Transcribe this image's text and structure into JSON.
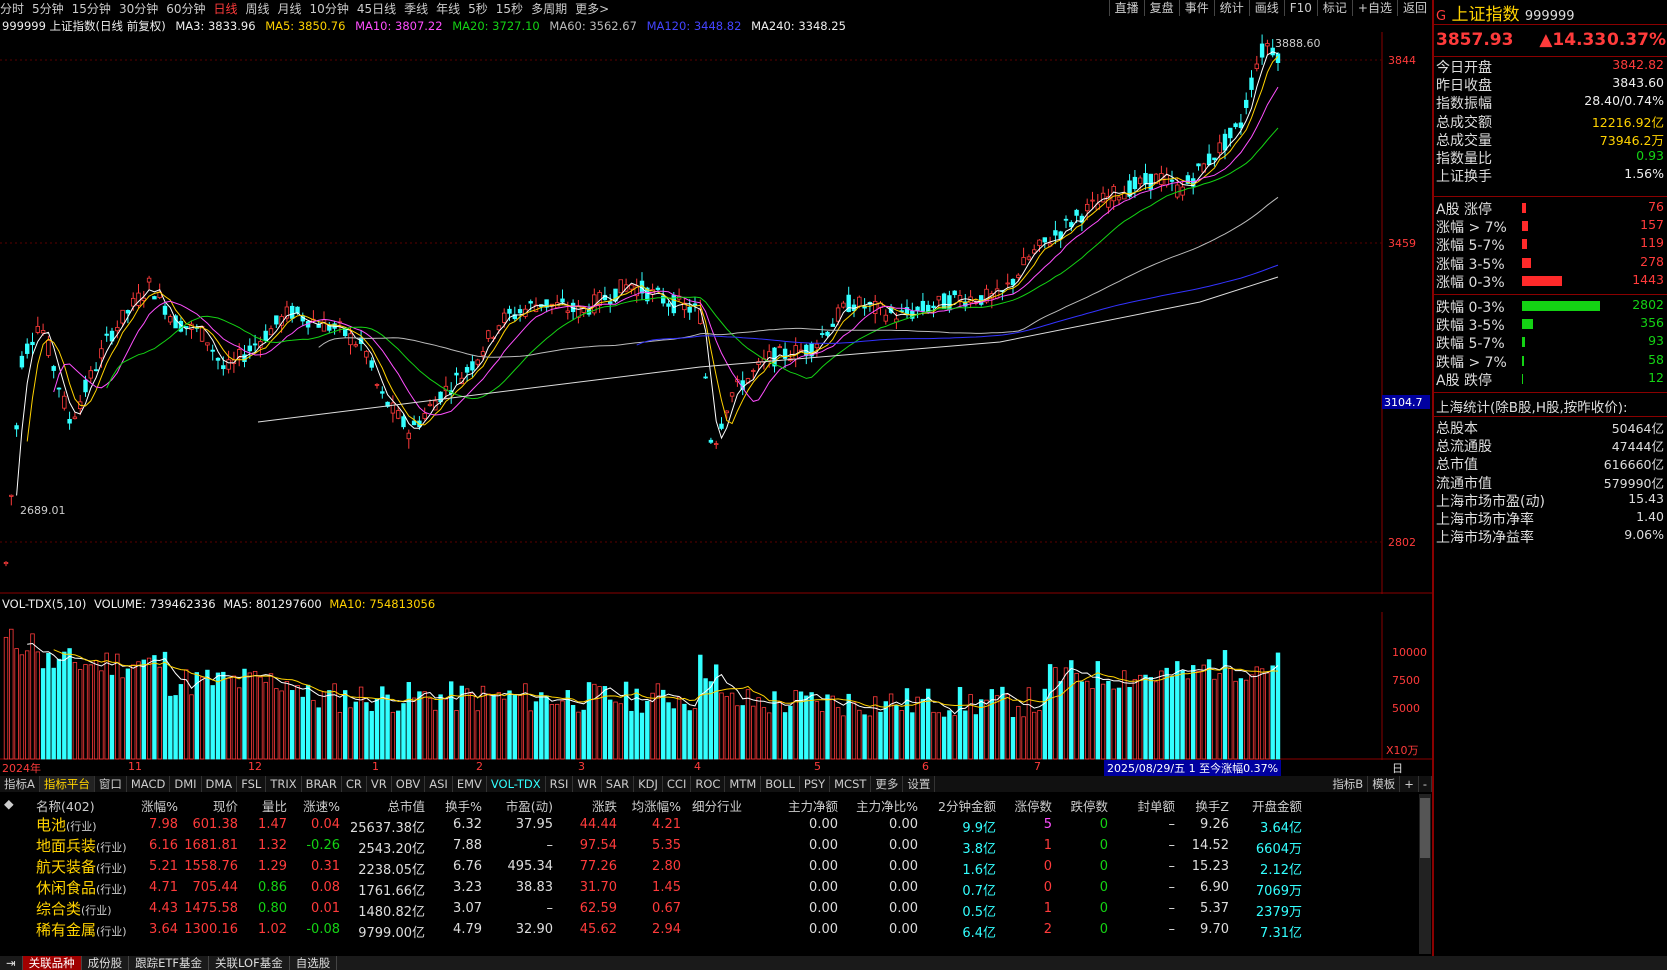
{
  "toolbar": {
    "periods": [
      "分时",
      "5分钟",
      "15分钟",
      "30分钟",
      "60分钟",
      "日线",
      "周线",
      "月线",
      "10分钟",
      "45日线",
      "季线",
      "年线",
      "5秒",
      "15秒",
      "多周期",
      "更多>"
    ],
    "active_period": "日线",
    "right_buttons": [
      "直播",
      "复盘",
      "事件",
      "统计",
      "画线",
      "F10",
      "标记",
      "+自选",
      "返回"
    ]
  },
  "ma_line": {
    "prefix": "999999 上证指数(日线 前复权)",
    "ma3": "MA3: 3833.96",
    "ma5": "MA5: 3850.76",
    "ma10": "MA10: 3807.22",
    "ma20": "MA20: 3727.10",
    "ma60": "MA60: 3562.67",
    "ma120": "MA120: 3448.82",
    "ma240": "MA240: 3348.25"
  },
  "price_axis": {
    "labels": [
      "3844",
      "3459",
      "3104.7",
      "2802"
    ],
    "high_marker": "3888.60",
    "low_marker": "2689.01"
  },
  "vol_line": {
    "prefix": "VOL-TDX(5,10)",
    "volume": "VOLUME: 739462336",
    "ma5": "MA5: 801297600",
    "ma10": "MA10: 754813056"
  },
  "vol_axis": {
    "labels": [
      "10000",
      "7500",
      "5000"
    ],
    "unit": "X10万"
  },
  "dates": {
    "labels": [
      "2024年",
      "11",
      "12",
      "1",
      "2",
      "3",
      "4",
      "5",
      "6",
      "7"
    ],
    "status": "2025/08/29/五 1 至今涨幅0.37%",
    "period": "日线"
  },
  "indicator_tabs": [
    "指标A",
    "指标平台",
    "窗口",
    "MACD",
    "DMI",
    "DMA",
    "FSL",
    "TRIX",
    "BRAR",
    "CR",
    "VR",
    "OBV",
    "ASI",
    "EMV",
    "VOL-TDX",
    "RSI",
    "WR",
    "SAR",
    "KDJ",
    "CCI",
    "ROC",
    "MTM",
    "BOLL",
    "PSY",
    "MCST",
    "更多",
    "设置"
  ],
  "indicator_right": [
    "指标B",
    "模板",
    "+",
    "-"
  ],
  "table": {
    "headers": [
      "名称(402)",
      "涨幅%",
      "现价",
      "量比",
      "涨速%",
      "总市值",
      "换手%",
      "市盈(动)",
      "涨跌",
      "均涨幅%",
      "细分行业",
      "主力净额",
      "主力净比%",
      "2分钟金额",
      "涨停数",
      "跌停数",
      "封单额",
      "换手Z",
      "开盘金额"
    ],
    "rows": [
      {
        "name": "电池",
        "tag": "(行业)",
        "chg": "7.98",
        "price": "601.38",
        "vr": "1.47",
        "spd": "0.04",
        "mcap": "25637.38亿",
        "turn": "6.32",
        "pe": "37.95",
        "diff": "44.44",
        "avg": "4.21",
        "main": "0.00",
        "mainr": "0.00",
        "m2": "9.9亿",
        "up": "5",
        "down": "0",
        "seal": "–",
        "tz": "9.26",
        "open": "3.64亿"
      },
      {
        "name": "地面兵装",
        "tag": "(行业)",
        "chg": "6.16",
        "price": "1681.81",
        "vr": "1.32",
        "spd": "-0.26",
        "mcap": "2543.20亿",
        "turn": "7.88",
        "pe": "–",
        "diff": "97.54",
        "avg": "5.35",
        "main": "0.00",
        "mainr": "0.00",
        "m2": "3.8亿",
        "up": "1",
        "down": "0",
        "seal": "–",
        "tz": "14.52",
        "open": "6604万"
      },
      {
        "name": "航天装备",
        "tag": "(行业)",
        "chg": "5.21",
        "price": "1558.76",
        "vr": "1.29",
        "spd": "0.31",
        "mcap": "2238.05亿",
        "turn": "6.76",
        "pe": "495.34",
        "diff": "77.26",
        "avg": "2.80",
        "main": "0.00",
        "mainr": "0.00",
        "m2": "1.6亿",
        "up": "0",
        "down": "0",
        "seal": "–",
        "tz": "15.23",
        "open": "2.12亿"
      },
      {
        "name": "休闲食品",
        "tag": "(行业)",
        "chg": "4.71",
        "price": "705.44",
        "vr": "0.86",
        "spd": "0.08",
        "mcap": "1761.66亿",
        "turn": "3.23",
        "pe": "38.83",
        "diff": "31.70",
        "avg": "1.45",
        "main": "0.00",
        "mainr": "0.00",
        "m2": "0.7亿",
        "up": "0",
        "down": "0",
        "seal": "–",
        "tz": "6.90",
        "open": "7069万"
      },
      {
        "name": "综合类",
        "tag": "(行业)",
        "chg": "4.43",
        "price": "1475.58",
        "vr": "0.80",
        "spd": "0.01",
        "mcap": "1480.82亿",
        "turn": "3.07",
        "pe": "–",
        "diff": "62.59",
        "avg": "0.67",
        "main": "0.00",
        "mainr": "0.00",
        "m2": "0.5亿",
        "up": "1",
        "down": "0",
        "seal": "–",
        "tz": "5.37",
        "open": "2379万"
      },
      {
        "name": "稀有金属",
        "tag": "(行业)",
        "chg": "3.64",
        "price": "1300.16",
        "vr": "1.02",
        "spd": "-0.08",
        "mcap": "9799.00亿",
        "turn": "4.79",
        "pe": "32.90",
        "diff": "45.62",
        "avg": "2.94",
        "main": "0.00",
        "mainr": "0.00",
        "m2": "6.4亿",
        "up": "2",
        "down": "0",
        "seal": "–",
        "tz": "9.70",
        "open": "7.31亿"
      }
    ]
  },
  "bottom_tabs": [
    "关联品种",
    "成份股",
    "跟踪ETF基金",
    "关联LOF基金",
    "自选股"
  ],
  "panel": {
    "name": "上证指数",
    "code": "999999",
    "price": "3857.93",
    "change": "▲14.33",
    "pct": "0.37%",
    "stats": [
      {
        "k": "今日开盘",
        "v": "3842.82",
        "c": "redtxt"
      },
      {
        "k": "昨日收盘",
        "v": "3843.60",
        "c": "white"
      },
      {
        "k": "指数振幅",
        "v": "28.40/0.74%",
        "c": "white"
      },
      {
        "k": "总成交额",
        "v": "12216.92亿",
        "c": "yel"
      },
      {
        "k": "总成交量",
        "v": "73946.2万",
        "c": "yel"
      },
      {
        "k": "指数量比",
        "v": "0.93",
        "c": "grntxt"
      },
      {
        "k": "上证换手",
        "v": "1.56%",
        "c": "white"
      }
    ],
    "ups": [
      {
        "k": "A股 涨停",
        "v": "76",
        "w": 4
      },
      {
        "k": "涨幅 > 7%",
        "v": "157",
        "w": 6
      },
      {
        "k": "涨幅 5-7%",
        "v": "119",
        "w": 5
      },
      {
        "k": "涨幅 3-5%",
        "v": "278",
        "w": 9
      },
      {
        "k": "涨幅 0-3%",
        "v": "1443",
        "w": 40
      }
    ],
    "downs": [
      {
        "k": "跌幅 0-3%",
        "v": "2802",
        "w": 78
      },
      {
        "k": "跌幅 3-5%",
        "v": "356",
        "w": 11
      },
      {
        "k": "跌幅 5-7%",
        "v": "93",
        "w": 3
      },
      {
        "k": "跌幅 > 7%",
        "v": "58",
        "w": 2
      },
      {
        "k": "A股 跌停",
        "v": "12",
        "w": 1
      }
    ],
    "sh_title": "上海统计(除B股,H股,按昨收价):",
    "sh": [
      {
        "k": "总股本",
        "v": "50464亿"
      },
      {
        "k": "总流通股",
        "v": "47444亿"
      },
      {
        "k": "总市值",
        "v": "616660亿"
      },
      {
        "k": "流通市值",
        "v": "579990亿"
      },
      {
        "k": "上海市场市盈(动)",
        "v": "15.43"
      },
      {
        "k": "上海市场市净率",
        "v": "1.40"
      },
      {
        "k": "上海市场净益率",
        "v": "9.06%"
      }
    ]
  },
  "colors": {
    "up": "#ff3b3b",
    "down": "#3ff",
    "ma3": "#ffffff",
    "ma5": "#ffd200",
    "ma10": "#ff4fff",
    "ma20": "#14d214",
    "ma60": "#bbbbbb",
    "ma120": "#3333ff",
    "ma240": "#dddddd"
  }
}
